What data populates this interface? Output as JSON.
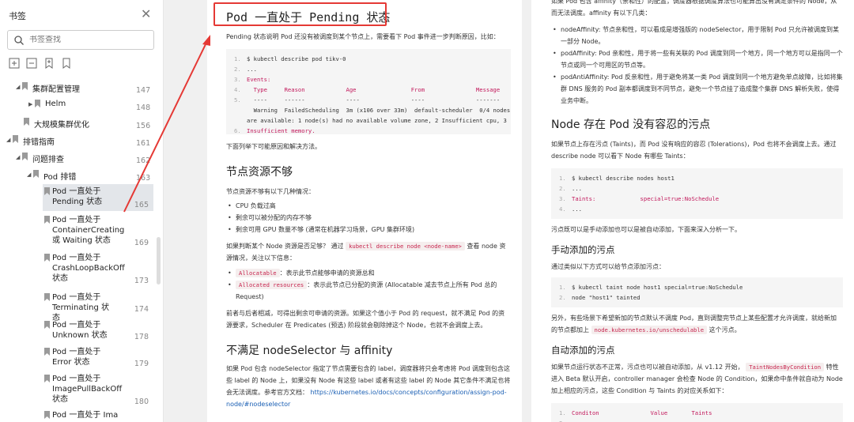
{
  "sidebar": {
    "title": "书签",
    "search_placeholder": "书签查找",
    "items": [
      {
        "label": "集群配置管理",
        "page": "147"
      },
      {
        "label": "Helm",
        "page": "148"
      },
      {
        "label": "大规模集群优化",
        "page": "156"
      },
      {
        "label": "排错指南",
        "page": "161"
      },
      {
        "label": "问题排查",
        "page": "162"
      },
      {
        "label": "Pod 排错",
        "page": "163"
      }
    ],
    "leaves": [
      {
        "label": "Pod 一直处于 Pending 状态",
        "page": "165"
      },
      {
        "label": "Pod 一直处于 ContainerCreating 或 Waiting 状态",
        "page": "169"
      },
      {
        "label": "Pod 一直处于 CrashLoopBackOff 状态",
        "page": "173"
      },
      {
        "label": "Pod 一直处于 Terminating 状态",
        "page": "174"
      },
      {
        "label": "Pod 一直处于 Unknown 状态",
        "page": "178"
      },
      {
        "label": "Pod 一直处于 Error 状态",
        "page": "179"
      },
      {
        "label": "Pod 一直处于 ImagePullBackOff 状态",
        "page": "180"
      },
      {
        "label": "Pod 一直处于 Ima",
        "page": ""
      }
    ]
  },
  "page1": {
    "title": "Pod 一直处于 Pending 状态",
    "intro": "Pending 状态说明 Pod 还没有被调度到某个节点上，需要看下 Pod 事件进一步判断原因，比如：",
    "code1": [
      "$ kubectl describe pod tikv-0",
      "...",
      "Events:",
      "  Type     Reason            Age                From               Message",
      "  ----     ------            ----               ----               -------",
      "  Warning  FailedScheduling  3m (x106 over 33m)  default-scheduler  0/4 nodes",
      "are available: 1 node(s) had no available volume zone, 2 Insufficient cpu, 3",
      "Insufficient memory."
    ],
    "after_code": "下面列举下可能原因和解决方法。",
    "h_resources": "节点资源不够",
    "res_intro": "节点资源不够有以下几种情况：",
    "res_items": [
      "CPU 负载过高",
      "剩余可以被分配的内存不够",
      "剩余可用 GPU 数量不够 (通常在机器学习场景，GPU 集群环境)"
    ],
    "check_text_a": "如果判断某个 Node 资源是否足够？ 通过",
    "check_cmd": "kubectl describe node <node-name>",
    "check_text_b": "查看 node 资源情况，关注以下信息：",
    "alloc_items": [
      {
        "code": "Allocatable",
        "text": "：表示此节点能够申请的资源总和"
      },
      {
        "code": "Allocated resources",
        "text": "：表示此节点已分配的资源 (Allocatable 减去节点上所有 Pod 总的 Request)"
      }
    ],
    "para_request": "前者与后者相减，可得出剩余可申请的资源。如果这个值小于 Pod 的 request，就不满足 Pod 的资源要求，Scheduler 在 Predicates (预选) 阶段就会剔除掉这个 Node，也就不会调度上去。",
    "h_selector": "不满足 nodeSelector 与 affinity",
    "para_selector": "如果 Pod 包含 nodeSelector 指定了节点需要包含的 label，调度器将只会考虑将 Pod 调度到包含这些 label 的 Node 上，如果没有 Node 有这些 label 或者有这些 label 的 Node 其它条件不满足也将会无法调度。参考官方文档：",
    "doc_link": "https://kubernetes.io/docs/concepts/configuration/assign-pod-node/#nodeselector"
  },
  "page2": {
    "top_text": "如果 Pod 包含 affinity（亲和性）的配置，调度器根据调度算法也可能算出没有满足条件的 Node，从而无法调度。affinity 有以下几类：",
    "aff_items": [
      "nodeAffinity: 节点亲和性，可以看成是增强版的 nodeSelector，用于限制 Pod 只允许被调度到某一部分 Node。",
      "podAffinity: Pod 亲和性，用于将一些有关联的 Pod 调度到同一个地方，同一个地方可以是指同一个节点或同一个可用区的节点等。",
      "podAntiAffinity: Pod 反亲和性，用于避免将某一类 Pod 调度到同一个地方避免单点故障，比如将集群 DNS 服务的 Pod 副本都调度到不同节点，避免一个节点挂了造成整个集群 DNS 解析失败，使得业务中断。"
    ],
    "h_taint": "Node 存在 Pod 没有容忍的污点",
    "taint_text": "如果节点上存在污点 (Taints)，而 Pod 没有响应的容忍 (Tolerations)，Pod 也将不会调度上去。通过 describe node 可以看下 Node 有哪些 Taints：",
    "code2": [
      "$ kubectl describe nodes host1",
      "...",
      "Taints:             special=true:NoSchedule",
      "..."
    ],
    "taint_after": "污点既可以是手动添加也可以是被自动添加，下面来深入分析一下。",
    "h_manual": "手动添加的污点",
    "manual_text": "通过类似以下方式可以给节点添加污点：",
    "code3": [
      "$ kubectl taint node host1 special=true:NoSchedule",
      "node \"host1\" tainted"
    ],
    "manual_after_a": "另外，有些场景下希望新加的节点默认不调度 Pod，直到调整完节点上某些配置才允许调度，就给新加的节点都加上",
    "manual_cmd": "node.kubernetes.io/unschedulable",
    "manual_after_b": "这个污点。",
    "h_auto": "自动添加的污点",
    "auto_text_a": "如果节点运行状态不正常，污点也可以被自动添加，从 v1.12 开始，",
    "auto_cmd": "TaintNodesByCondition",
    "auto_text_b": "特性进入 Beta 默认开启，controller manager 会检查 Node 的 Condition，如果命中条件就自动为 Node 加上相应的污点，这些 Condition 与 Taints 的对应关系如下：",
    "code4": [
      "Conditon               Value       Taints",
      "--------               -----       ------"
    ]
  },
  "colors": {
    "accent": "#e53935",
    "link": "#1a5fb4"
  }
}
